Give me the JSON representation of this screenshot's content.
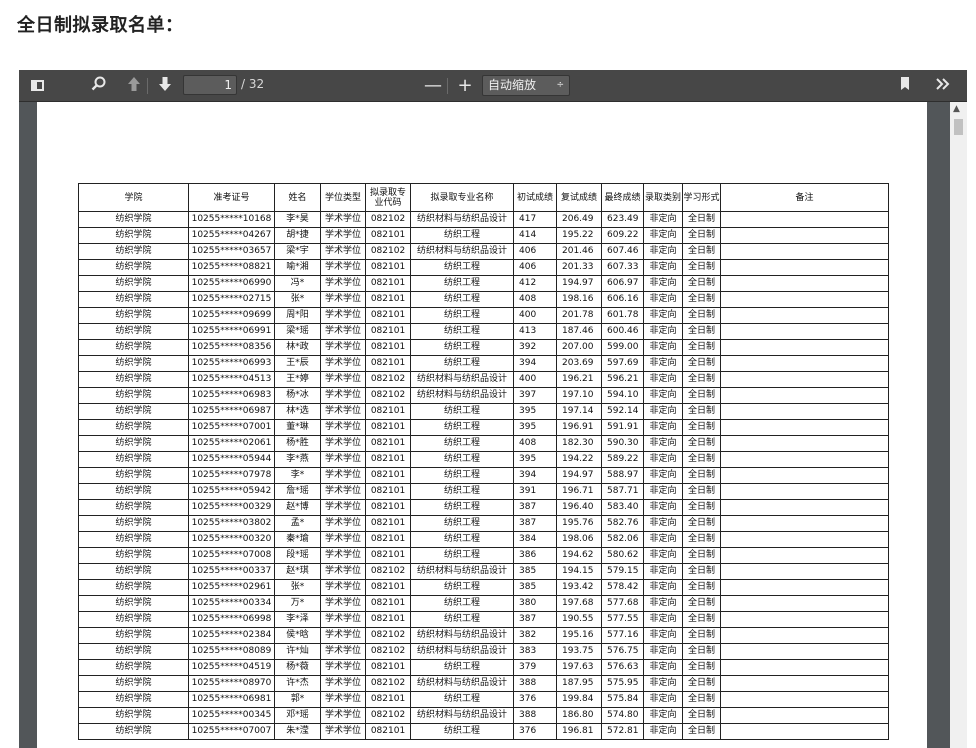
{
  "page_heading": "全日制拟录取名单：",
  "viewer": {
    "current_page": "1",
    "page_count": "/ 32",
    "zoom_minus": "—",
    "zoom_plus": "+",
    "zoom_label": "自动缩放",
    "zoom_caret": "÷"
  },
  "table": {
    "headers": [
      "学院",
      "准考证号",
      "姓名",
      "学位类型",
      "拟录取专业代码",
      "拟录取专业名称",
      "初试成绩",
      "复试成绩",
      "最终成绩",
      "录取类别",
      "学习形式",
      "备注"
    ],
    "rows": [
      [
        "纺织学院",
        "10255*****10168",
        "李*昊",
        "学术学位",
        "082102",
        "纺织材料与纺织品设计",
        "417",
        "206.49",
        "623.49",
        "非定向",
        "全日制",
        ""
      ],
      [
        "纺织学院",
        "10255*****04267",
        "胡*捷",
        "学术学位",
        "082101",
        "纺织工程",
        "414",
        "195.22",
        "609.22",
        "非定向",
        "全日制",
        ""
      ],
      [
        "纺织学院",
        "10255*****03657",
        "梁*宇",
        "学术学位",
        "082102",
        "纺织材料与纺织品设计",
        "406",
        "201.46",
        "607.46",
        "非定向",
        "全日制",
        ""
      ],
      [
        "纺织学院",
        "10255*****08821",
        "喻*湘",
        "学术学位",
        "082101",
        "纺织工程",
        "406",
        "201.33",
        "607.33",
        "非定向",
        "全日制",
        ""
      ],
      [
        "纺织学院",
        "10255*****06990",
        "冯*",
        "学术学位",
        "082101",
        "纺织工程",
        "412",
        "194.97",
        "606.97",
        "非定向",
        "全日制",
        ""
      ],
      [
        "纺织学院",
        "10255*****02715",
        "张*",
        "学术学位",
        "082101",
        "纺织工程",
        "408",
        "198.16",
        "606.16",
        "非定向",
        "全日制",
        ""
      ],
      [
        "纺织学院",
        "10255*****09699",
        "周*阳",
        "学术学位",
        "082101",
        "纺织工程",
        "400",
        "201.78",
        "601.78",
        "非定向",
        "全日制",
        ""
      ],
      [
        "纺织学院",
        "10255*****06991",
        "梁*瑶",
        "学术学位",
        "082101",
        "纺织工程",
        "413",
        "187.46",
        "600.46",
        "非定向",
        "全日制",
        ""
      ],
      [
        "纺织学院",
        "10255*****08356",
        "林*政",
        "学术学位",
        "082101",
        "纺织工程",
        "392",
        "207.00",
        "599.00",
        "非定向",
        "全日制",
        ""
      ],
      [
        "纺织学院",
        "10255*****06993",
        "王*辰",
        "学术学位",
        "082101",
        "纺织工程",
        "394",
        "203.69",
        "597.69",
        "非定向",
        "全日制",
        ""
      ],
      [
        "纺织学院",
        "10255*****04513",
        "王*婷",
        "学术学位",
        "082102",
        "纺织材料与纺织品设计",
        "400",
        "196.21",
        "596.21",
        "非定向",
        "全日制",
        ""
      ],
      [
        "纺织学院",
        "10255*****06983",
        "杨*冰",
        "学术学位",
        "082102",
        "纺织材料与纺织品设计",
        "397",
        "197.10",
        "594.10",
        "非定向",
        "全日制",
        ""
      ],
      [
        "纺织学院",
        "10255*****06987",
        "林*选",
        "学术学位",
        "082101",
        "纺织工程",
        "395",
        "197.14",
        "592.14",
        "非定向",
        "全日制",
        ""
      ],
      [
        "纺织学院",
        "10255*****07001",
        "董*琳",
        "学术学位",
        "082101",
        "纺织工程",
        "395",
        "196.91",
        "591.91",
        "非定向",
        "全日制",
        ""
      ],
      [
        "纺织学院",
        "10255*****02061",
        "杨*胜",
        "学术学位",
        "082101",
        "纺织工程",
        "408",
        "182.30",
        "590.30",
        "非定向",
        "全日制",
        ""
      ],
      [
        "纺织学院",
        "10255*****05944",
        "李*燕",
        "学术学位",
        "082101",
        "纺织工程",
        "395",
        "194.22",
        "589.22",
        "非定向",
        "全日制",
        ""
      ],
      [
        "纺织学院",
        "10255*****07978",
        "李*",
        "学术学位",
        "082101",
        "纺织工程",
        "394",
        "194.97",
        "588.97",
        "非定向",
        "全日制",
        ""
      ],
      [
        "纺织学院",
        "10255*****05942",
        "詹*瑶",
        "学术学位",
        "082101",
        "纺织工程",
        "391",
        "196.71",
        "587.71",
        "非定向",
        "全日制",
        ""
      ],
      [
        "纺织学院",
        "10255*****00329",
        "赵*博",
        "学术学位",
        "082101",
        "纺织工程",
        "387",
        "196.40",
        "583.40",
        "非定向",
        "全日制",
        ""
      ],
      [
        "纺织学院",
        "10255*****03802",
        "孟*",
        "学术学位",
        "082101",
        "纺织工程",
        "387",
        "195.76",
        "582.76",
        "非定向",
        "全日制",
        ""
      ],
      [
        "纺织学院",
        "10255*****00320",
        "秦*瑜",
        "学术学位",
        "082101",
        "纺织工程",
        "384",
        "198.06",
        "582.06",
        "非定向",
        "全日制",
        ""
      ],
      [
        "纺织学院",
        "10255*****07008",
        "段*瑶",
        "学术学位",
        "082101",
        "纺织工程",
        "386",
        "194.62",
        "580.62",
        "非定向",
        "全日制",
        ""
      ],
      [
        "纺织学院",
        "10255*****00337",
        "赵*琪",
        "学术学位",
        "082102",
        "纺织材料与纺织品设计",
        "385",
        "194.15",
        "579.15",
        "非定向",
        "全日制",
        ""
      ],
      [
        "纺织学院",
        "10255*****02961",
        "张*",
        "学术学位",
        "082101",
        "纺织工程",
        "385",
        "193.42",
        "578.42",
        "非定向",
        "全日制",
        ""
      ],
      [
        "纺织学院",
        "10255*****00334",
        "万*",
        "学术学位",
        "082101",
        "纺织工程",
        "380",
        "197.68",
        "577.68",
        "非定向",
        "全日制",
        ""
      ],
      [
        "纺织学院",
        "10255*****06998",
        "李*泽",
        "学术学位",
        "082101",
        "纺织工程",
        "387",
        "190.55",
        "577.55",
        "非定向",
        "全日制",
        ""
      ],
      [
        "纺织学院",
        "10255*****02384",
        "侯*晗",
        "学术学位",
        "082102",
        "纺织材料与纺织品设计",
        "382",
        "195.16",
        "577.16",
        "非定向",
        "全日制",
        ""
      ],
      [
        "纺织学院",
        "10255*****08089",
        "许*灿",
        "学术学位",
        "082102",
        "纺织材料与纺织品设计",
        "383",
        "193.75",
        "576.75",
        "非定向",
        "全日制",
        ""
      ],
      [
        "纺织学院",
        "10255*****04519",
        "杨*薇",
        "学术学位",
        "082101",
        "纺织工程",
        "379",
        "197.63",
        "576.63",
        "非定向",
        "全日制",
        ""
      ],
      [
        "纺织学院",
        "10255*****08970",
        "许*杰",
        "学术学位",
        "082102",
        "纺织材料与纺织品设计",
        "388",
        "187.95",
        "575.95",
        "非定向",
        "全日制",
        ""
      ],
      [
        "纺织学院",
        "10255*****06981",
        "郭*",
        "学术学位",
        "082101",
        "纺织工程",
        "376",
        "199.84",
        "575.84",
        "非定向",
        "全日制",
        ""
      ],
      [
        "纺织学院",
        "10255*****00345",
        "邓*瑶",
        "学术学位",
        "082102",
        "纺织材料与纺织品设计",
        "388",
        "186.80",
        "574.80",
        "非定向",
        "全日制",
        ""
      ],
      [
        "纺织学院",
        "10255*****07007",
        "朱*滢",
        "学术学位",
        "082101",
        "纺织工程",
        "376",
        "196.81",
        "572.81",
        "非定向",
        "全日制",
        ""
      ]
    ]
  }
}
